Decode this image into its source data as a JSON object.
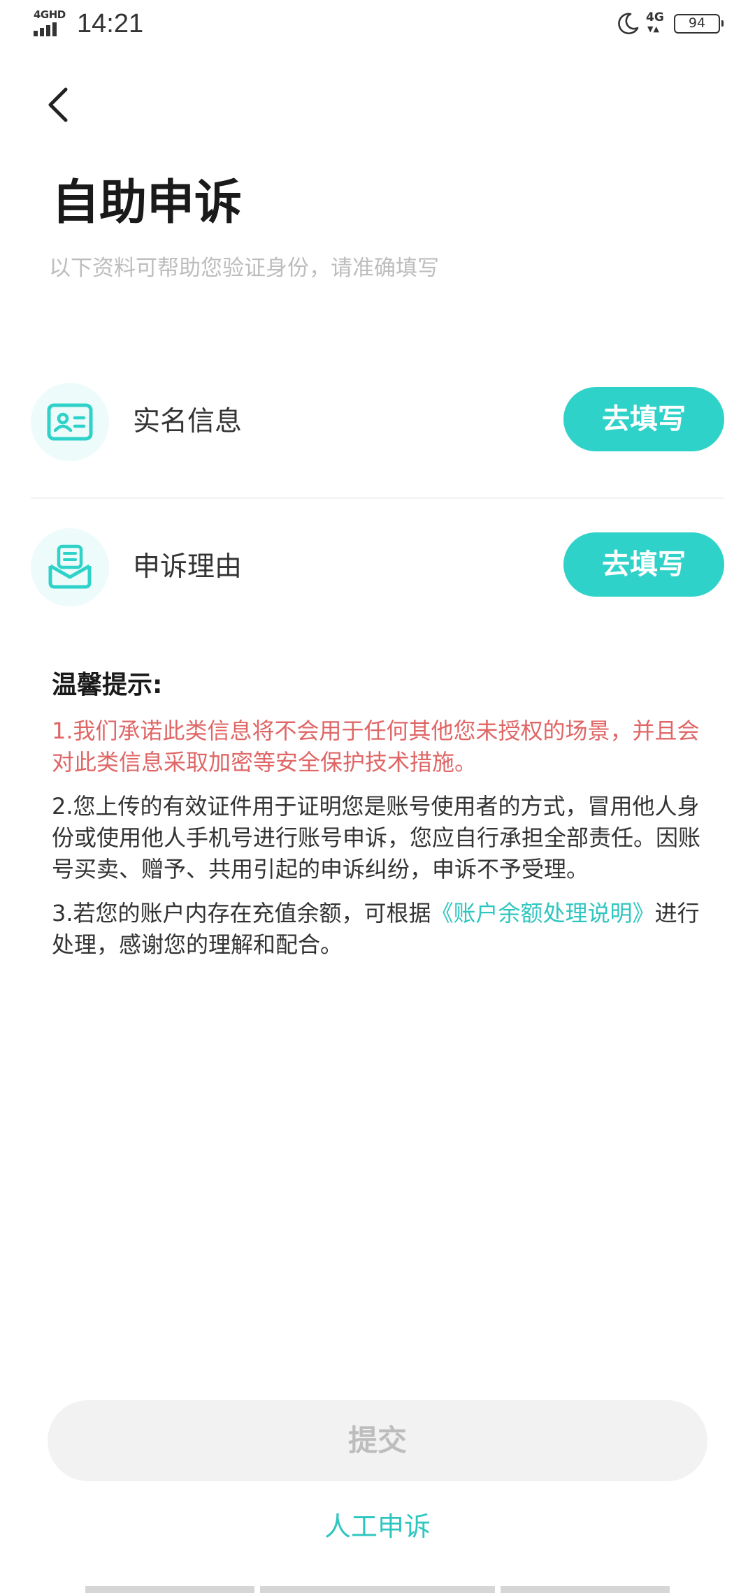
{
  "status_bar": {
    "network_tag": "4GHD",
    "time": "14:21",
    "network_right": "4G",
    "battery": "94"
  },
  "header": {
    "title": "自助申诉",
    "subtitle": "以下资料可帮助您验证身份，请准确填写"
  },
  "rows": [
    {
      "label": "实名信息",
      "button": "去填写",
      "icon": "id-card-icon"
    },
    {
      "label": "申诉理由",
      "button": "去填写",
      "icon": "envelope-document-icon"
    }
  ],
  "tips": {
    "title": "温馨提示:",
    "item1": "1.我们承诺此类信息将不会用于任何其他您未授权的场景，并且会对此类信息采取加密等安全保护技术措施。",
    "item2": "2.您上传的有效证件用于证明您是账号使用者的方式，冒用他人身份或使用他人手机号进行账号申诉，您应自行承担全部责任。因账号买卖、赠予、共用引起的申诉纠纷，申诉不予受理。",
    "item3_prefix": "3.若您的账户内存在充值余额，可根据",
    "item3_link": "《账户余额处理说明》",
    "item3_suffix": "进行处理，感谢您的理解和配合。"
  },
  "footer": {
    "submit": "提交",
    "manual_appeal": "人工申诉"
  },
  "colors": {
    "accent": "#2fd2c8",
    "warning": "#e06666",
    "link": "#2fc6c0"
  }
}
